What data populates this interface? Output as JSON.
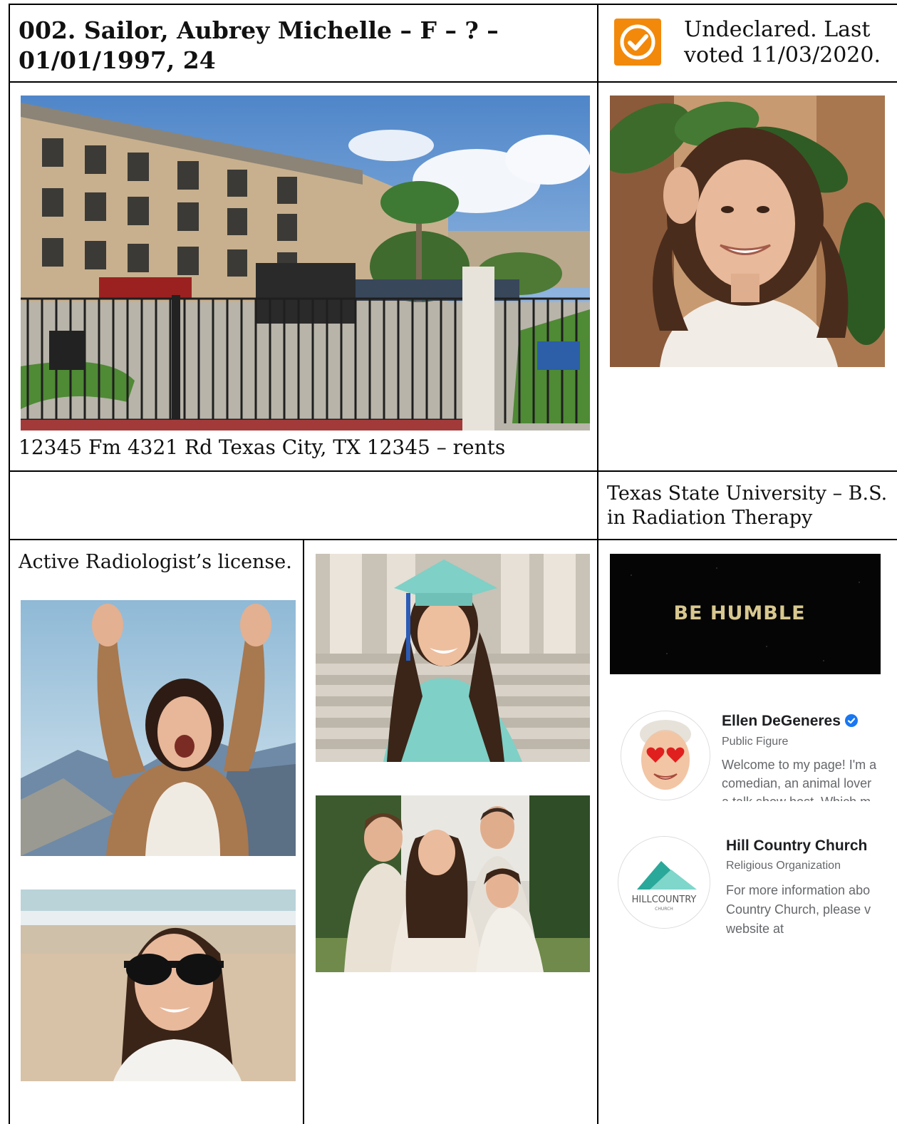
{
  "record": {
    "title": "002. Sailor, Aubrey Michelle – F – ? – 01/01/1997, 24",
    "voting_status": "Undeclared. Last voted 11/03/2020.",
    "address": "12345 Fm 4321 Rd Texas City, TX 12345 – rents",
    "education": "Texas State University – B.S. in Radiation Therapy",
    "license": "Active Radiologist’s license."
  },
  "banner": {
    "text": "BE HUMBLE"
  },
  "likes": [
    {
      "name": "Ellen DeGeneres",
      "category": "Public Figure",
      "description_line1": "Welcome to my page! I'm a",
      "description_line2": "comedian, an animal lover",
      "description_line3": "a talk show host. Which m",
      "verified": true
    },
    {
      "name": "Hill Country Church",
      "category": "Religious Organization",
      "description_line1": "For more information abo",
      "description_line2": "Country Church, please v",
      "description_line3": "website at",
      "logo_text": "HILLCOUNTRY",
      "logo_subtext": "CHURCH"
    }
  ],
  "colors": {
    "badge_orange": "#f2890b",
    "verified_blue": "#1877f2",
    "logo_teal": "#2aa899"
  }
}
